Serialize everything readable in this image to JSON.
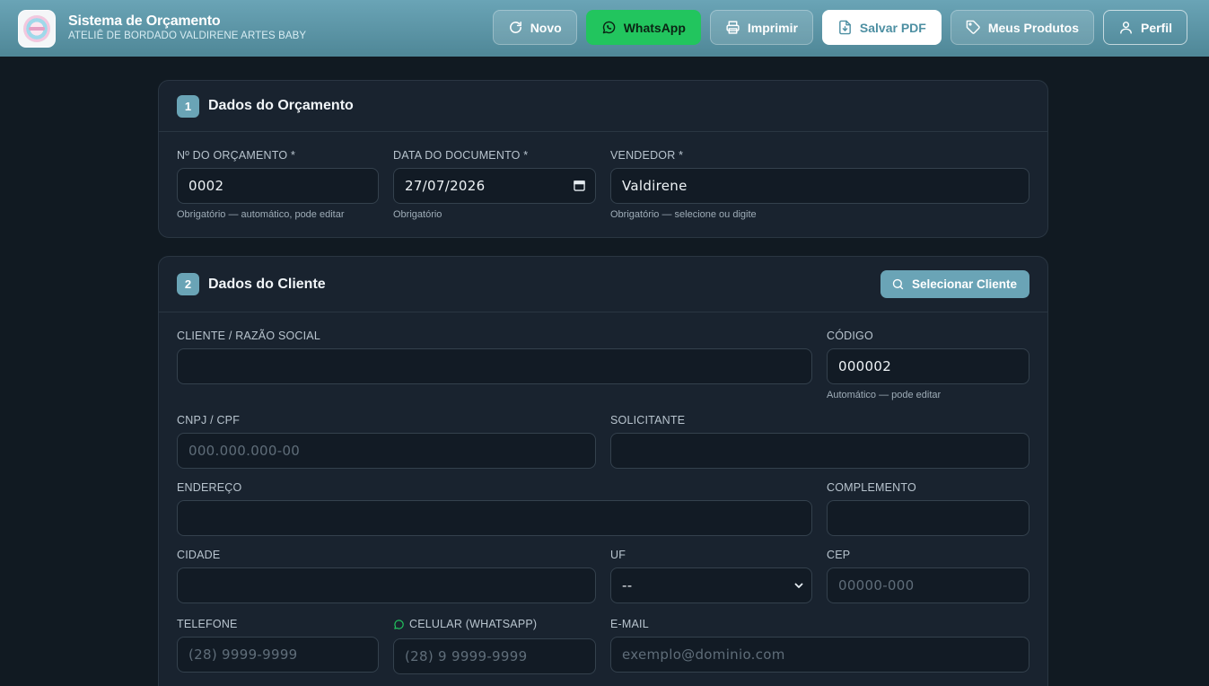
{
  "header": {
    "title": "Sistema de Orçamento",
    "subtitle": "ATELIÊ DE BORDADO VALDIRENE ARTES BABY",
    "buttons": {
      "novo": "Novo",
      "whatsapp": "WhatsApp",
      "imprimir": "Imprimir",
      "salvar_pdf": "Salvar PDF",
      "meus_produtos": "Meus Produtos",
      "perfil": "Perfil"
    }
  },
  "section1": {
    "step": "1",
    "title": "Dados do Orçamento",
    "numero": {
      "label": "Nº DO ORÇAMENTO *",
      "value": "0002",
      "hint": "Obrigatório — automático, pode editar"
    },
    "data": {
      "label": "DATA DO DOCUMENTO *",
      "value": "27/07/2026",
      "hint": "Obrigatório"
    },
    "vendedor": {
      "label": "VENDEDOR *",
      "value": "Valdirene",
      "hint": "Obrigatório — selecione ou digite"
    }
  },
  "section2": {
    "step": "2",
    "title": "Dados do Cliente",
    "select_button": "Selecionar Cliente",
    "cliente": {
      "label": "CLIENTE / RAZÃO SOCIAL",
      "value": ""
    },
    "codigo": {
      "label": "CÓDIGO",
      "value": "000002",
      "hint": "Automático — pode editar"
    },
    "cnpj": {
      "label": "CNPJ / CPF",
      "placeholder": "000.000.000-00"
    },
    "solicitante": {
      "label": "SOLICITANTE",
      "value": ""
    },
    "endereco": {
      "label": "ENDEREÇO",
      "value": ""
    },
    "complemento": {
      "label": "COMPLEMENTO",
      "value": ""
    },
    "cidade": {
      "label": "CIDADE",
      "value": ""
    },
    "uf": {
      "label": "UF",
      "selected": "--"
    },
    "cep": {
      "label": "CEP",
      "placeholder": "00000-000"
    },
    "telefone": {
      "label": "TELEFONE",
      "placeholder": "(28) 9999-9999"
    },
    "celular": {
      "label": "CELULAR (WHATSAPP)",
      "placeholder": "(28) 9 9999-9999"
    },
    "email": {
      "label": "E-MAIL",
      "placeholder": "exemplo@dominio.com"
    }
  },
  "colors": {
    "accent": "#6aa4b6",
    "whatsapp": "#22c55e",
    "background": "#111a22",
    "card": "#19232f"
  },
  "icons": [
    "refresh-icon",
    "whatsapp-icon",
    "printer-icon",
    "file-download-icon",
    "tag-icon",
    "user-icon",
    "search-icon",
    "calendar-icon",
    "chevron-down-icon"
  ]
}
